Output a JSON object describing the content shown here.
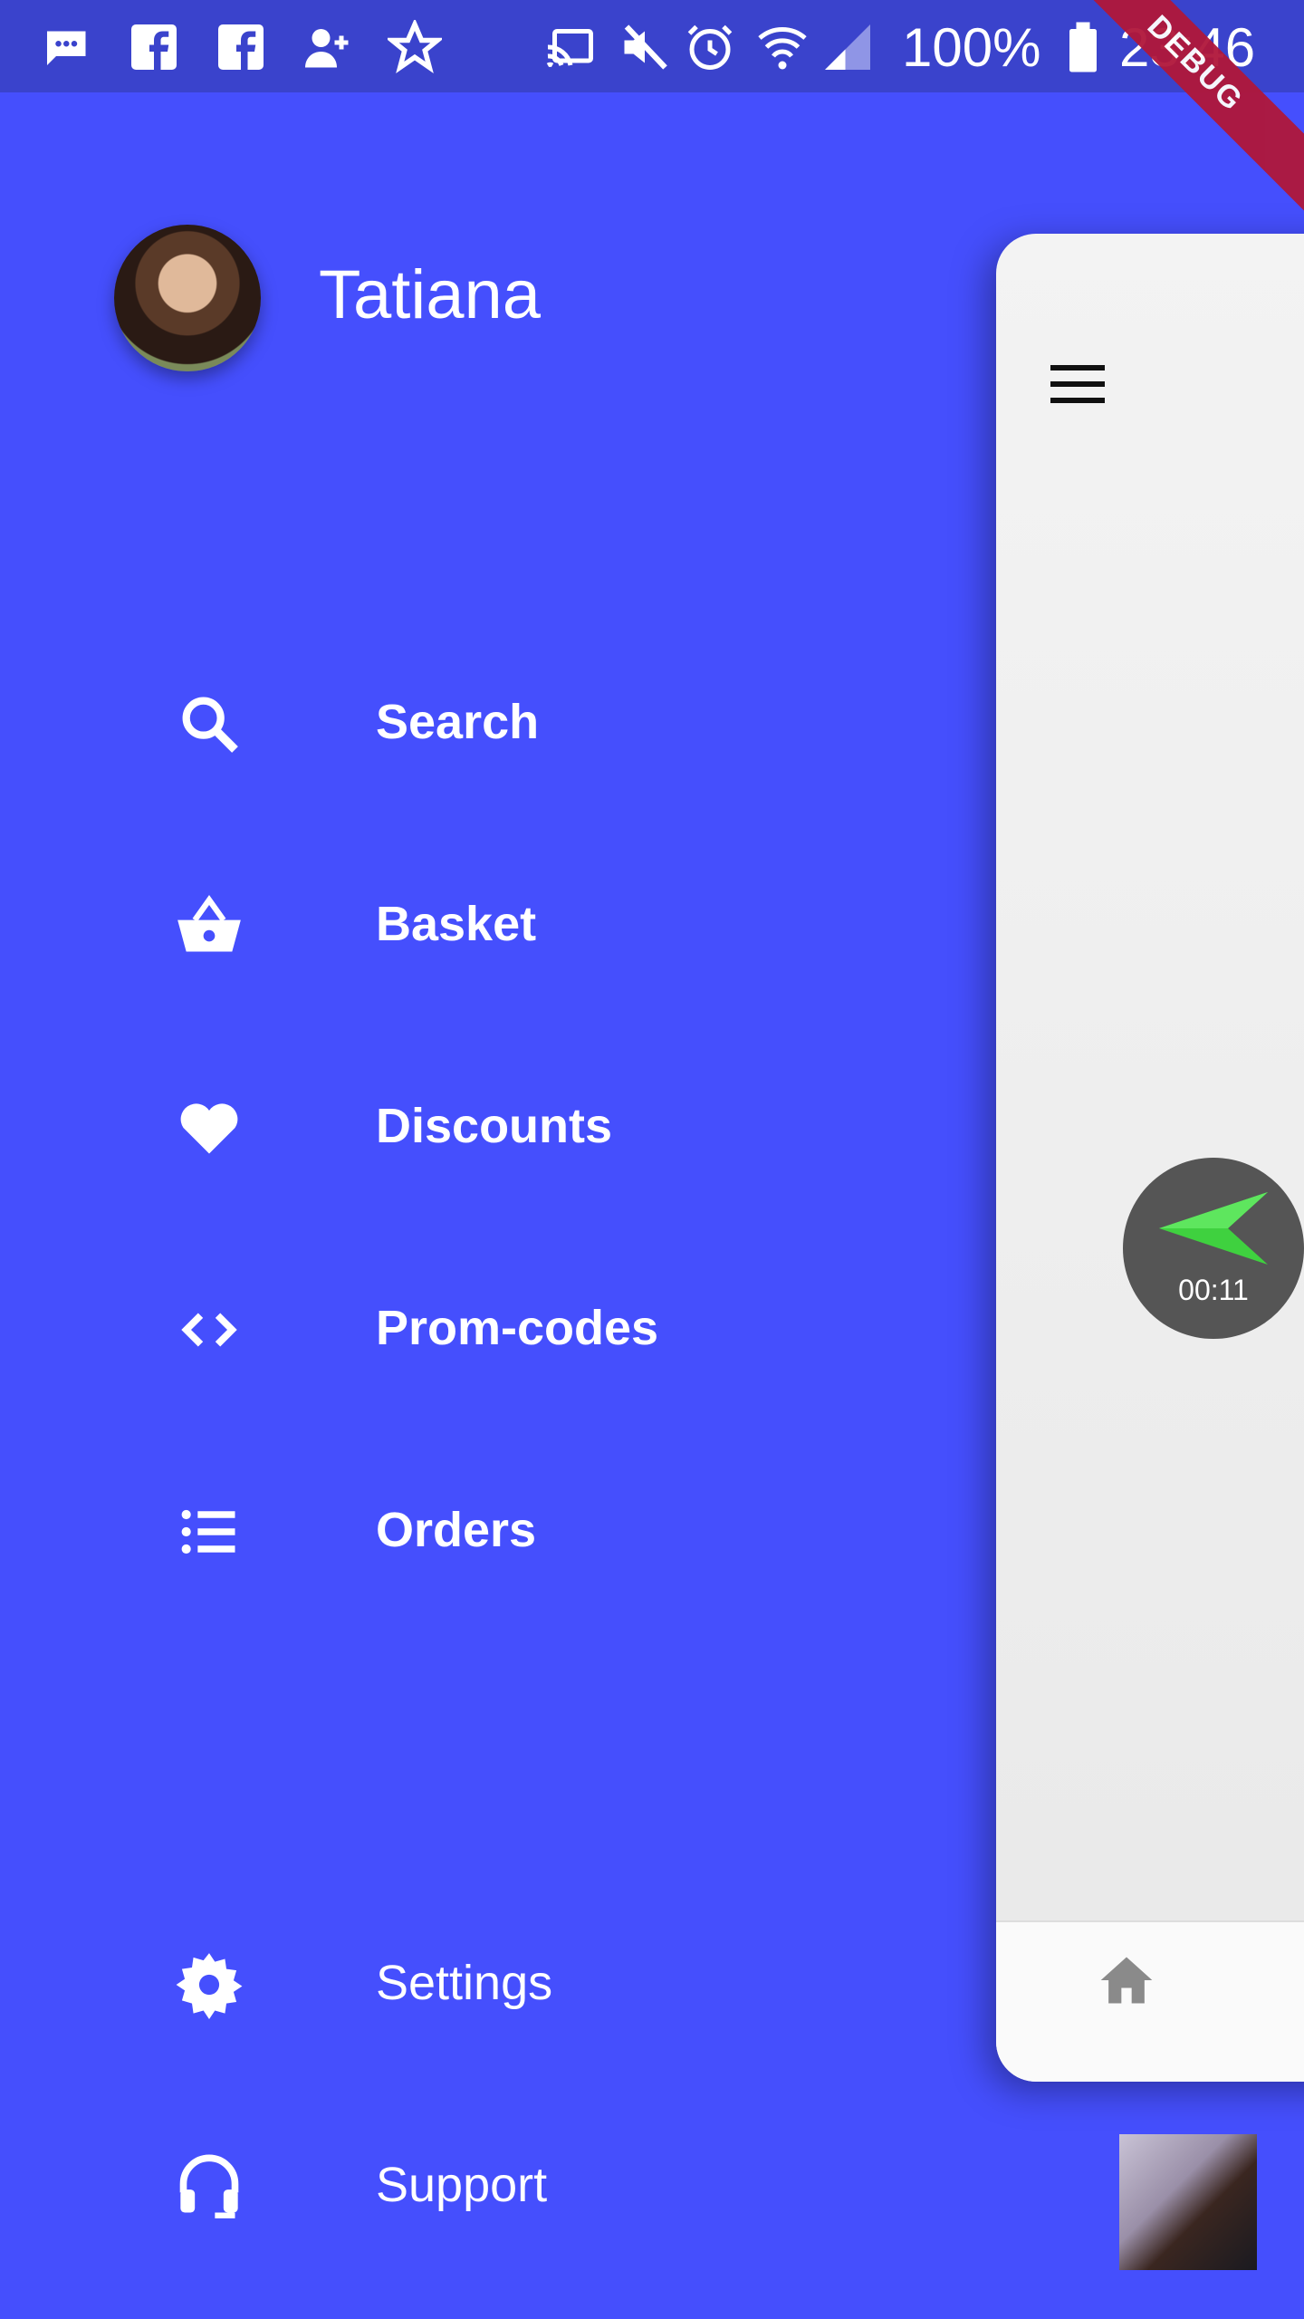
{
  "status_bar": {
    "battery_percent": "100%",
    "time": "23:46",
    "icons": [
      "message-icon",
      "facebook-icon",
      "facebook-icon",
      "add-contact-icon",
      "star-icon",
      "cast-icon",
      "mute-icon",
      "alarm-icon",
      "wifi-icon",
      "signal-icon",
      "battery-icon"
    ]
  },
  "debug_banner": "DEBUG",
  "drawer": {
    "user_name": "Tatiana",
    "menu_items": [
      {
        "label": "Search",
        "icon": "search-icon"
      },
      {
        "label": "Basket",
        "icon": "basket-icon"
      },
      {
        "label": "Discounts",
        "icon": "heart-icon"
      },
      {
        "label": "Prom-codes",
        "icon": "code-icon"
      },
      {
        "label": "Orders",
        "icon": "list-icon"
      }
    ],
    "footer_items": [
      {
        "label": "Settings",
        "icon": "gear-icon"
      },
      {
        "label": "Support",
        "icon": "headset-icon"
      }
    ]
  },
  "main_panel": {
    "menu_icon": "hamburger-icon",
    "bottom_nav_icon": "home-icon"
  },
  "recorder": {
    "elapsed": "00:11",
    "icon": "paper-plane-icon"
  },
  "colors": {
    "drawer_background": "#454ffd",
    "status_bar": "#3a43cc",
    "panel_background": "#eeeeee",
    "recorder_green": "#3fd13f"
  }
}
